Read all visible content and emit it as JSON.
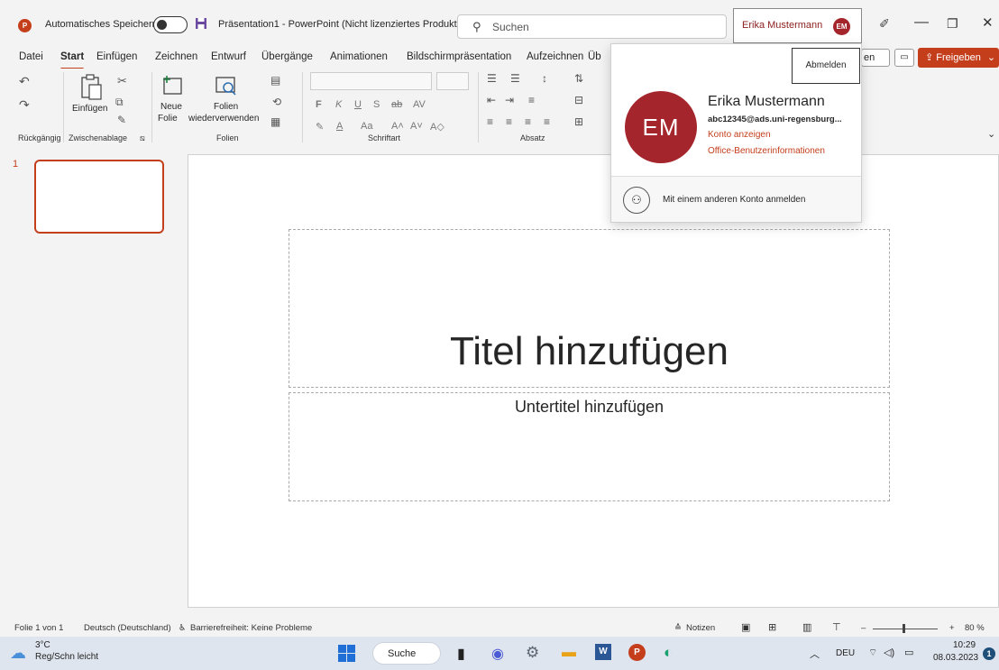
{
  "titlebar": {
    "autosave_label": "Automatisches Speichern",
    "doc_title": "Präsentation1 - PowerPoint (Nicht lizenziertes Produkt)",
    "search_placeholder": "Suchen",
    "user_name": "Erika Mustermann",
    "user_initials": "EM"
  },
  "tabs": [
    "Datei",
    "Start",
    "Einfügen",
    "Zeichnen",
    "Entwurf",
    "Übergänge",
    "Animationen",
    "Bildschirmpräsentation",
    "Aufzeichnen",
    "Üb"
  ],
  "tab_buttons": {
    "partial_label": "en",
    "share_label": "Freigeben"
  },
  "ribbon": {
    "undo_group": "Rückgängig",
    "clipboard_group": "Zwischenablage",
    "paste_label": "Einfügen",
    "new_slide_label_1": "Neue",
    "new_slide_label_2": "Folie",
    "reuse_label_1": "Folien",
    "reuse_label_2": "wiederverwenden",
    "slides_group": "Folien",
    "font_group": "Schriftart",
    "paragraph_group": "Absatz"
  },
  "thumbnails": {
    "slide_number": "1"
  },
  "slide": {
    "title_placeholder": "Titel hinzufügen",
    "subtitle_placeholder": "Untertitel hinzufügen"
  },
  "account_flyout": {
    "signout_label": "Abmelden",
    "initials": "EM",
    "name": "Erika Mustermann",
    "email": "abc12345@ads.uni-regensburg...",
    "view_account_link": "Konto anzeigen",
    "office_info_link": "Office-Benutzerinformationen",
    "other_account_label": "Mit einem anderen Konto anmelden"
  },
  "statusbar": {
    "slide_info": "Folie 1 von 1",
    "language": "Deutsch (Deutschland)",
    "accessibility": "Barrierefreiheit: Keine Probleme",
    "notes_label": "Notizen",
    "zoom_level": "80 %"
  },
  "taskbar": {
    "weather_temp": "3°C",
    "weather_desc": "Reg/Schn leicht",
    "search_label": "Suche",
    "language": "DEU",
    "time": "10:29",
    "date": "08.03.2023",
    "notification_count": "1"
  },
  "colors": {
    "accent": "#c43e1c",
    "avatar": "#a4262c"
  }
}
